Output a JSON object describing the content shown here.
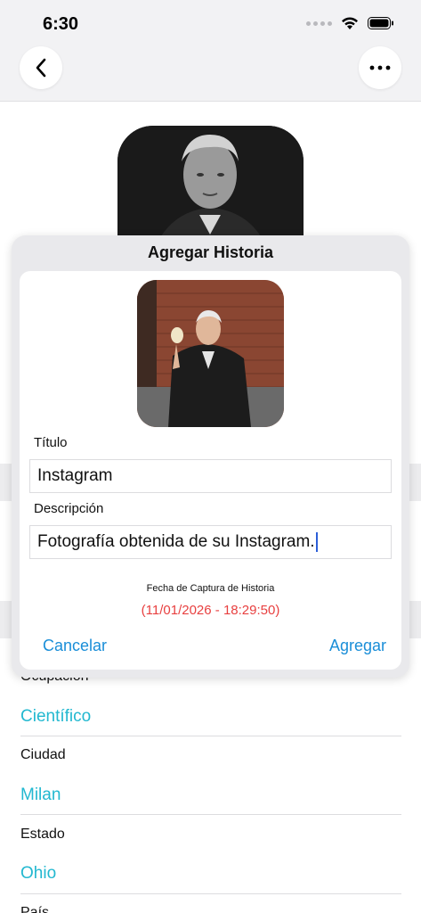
{
  "status_bar": {
    "time": "6:30"
  },
  "nav": {
    "back_icon": "chevron-left-icon",
    "more_icon": "ellipsis-icon"
  },
  "dialog": {
    "title": "Agregar Historia",
    "title_label": "Título",
    "title_value": "Instagram",
    "description_label": "Descripción",
    "description_value": "Fotografía obtenida de su Instagram.",
    "date_label": "Fecha de Captura de Historia",
    "date_value": "(11/01/2026 - 18:29:50)",
    "cancel_label": "Cancelar",
    "add_label": "Agregar"
  },
  "details": {
    "occupation_label": "Ocupación",
    "occupation_value": "Científico",
    "city_label": "Ciudad",
    "city_value": "Milan",
    "state_label": "Estado",
    "state_value": "Ohio",
    "country_label": "País"
  },
  "colors": {
    "accent_link": "#1a8ed8",
    "value_cyan": "#22b8d0",
    "date_red": "#e84040"
  }
}
